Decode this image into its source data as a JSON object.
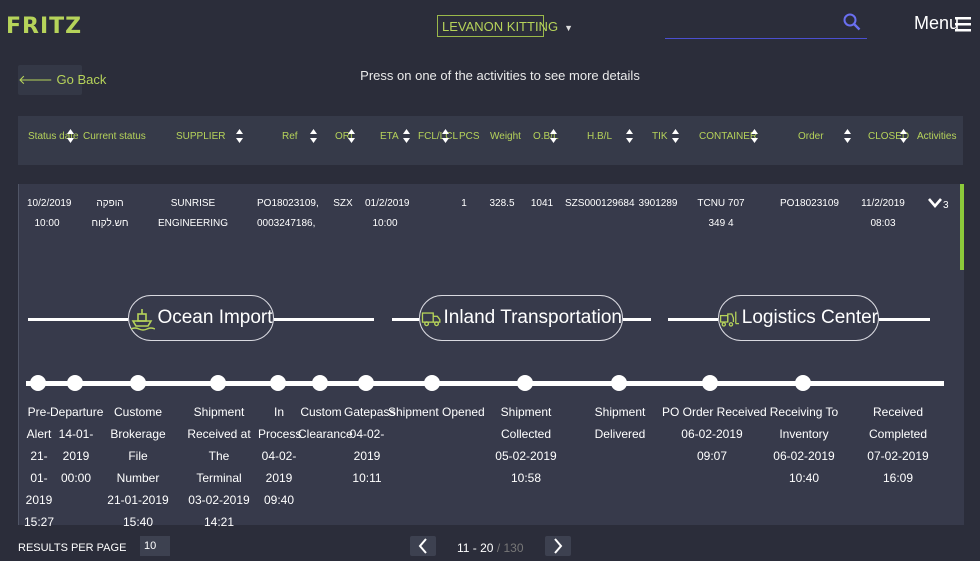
{
  "header": {
    "logo": "FRITZ",
    "customer": "LEVANON KITTING",
    "menu_label": "Menu"
  },
  "nav": {
    "go_back": "Go Back",
    "instructions": "Press on one of the activities to see more details"
  },
  "table": {
    "columns": [
      "Status date",
      "Current status",
      "SUPPLIER",
      "Ref",
      "ORI",
      "ETA",
      "FCL/LCL",
      "PCS",
      "Weight",
      "O.B/L",
      "H.B/L",
      "TIK",
      "CONTAINER",
      "Order",
      "CLOSED",
      "Activities"
    ],
    "row": {
      "status_date_1": "10/2/2019",
      "status_date_2": "10:00",
      "current_status": "הופקה חש.לקוח",
      "supplier": "SUNRISE ENGINEERING",
      "ref_1": "PO18023109,",
      "ref_2": "0003247186,",
      "ori": "SZX",
      "eta_1": "01/2/2019",
      "eta_2": "10:00",
      "pcs": "1",
      "weight": "328.5",
      "obl": "1041",
      "hbl": "SZS000129684",
      "tik": "3901289",
      "container": "TCNU 707 349 4",
      "order": "PO18023109",
      "closed_1": "11/2/2019",
      "closed_2": "08:03",
      "activities_count": "3"
    }
  },
  "stages": [
    "Ocean Import",
    "Inland Transportation",
    "Logistics Center"
  ],
  "activities": [
    {
      "l1": "Pre-",
      "l2": "Alert",
      "l3": "21-",
      "l4": "01-",
      "l5": "2019",
      "l6": "15:27"
    },
    {
      "l1": "Departure",
      "l2": "14-01-",
      "l3": "2019",
      "l4": "00:00"
    },
    {
      "l1": "Custome",
      "l2": "Brokerage File",
      "l3": "Number",
      "l4": "21-01-2019",
      "l5": "15:40"
    },
    {
      "l1": "Shipment",
      "l2": "Received at The",
      "l3": "Terminal",
      "l4": "03-02-2019",
      "l5": "14:21"
    },
    {
      "l1": "In",
      "l2": "Process",
      "l3": "04-02-",
      "l4": "2019",
      "l5": "09:40"
    },
    {
      "l1": "Custom",
      "l2": "Clearance"
    },
    {
      "l1": "Gatepass",
      "l2": "04-02-",
      "l3": "2019",
      "l4": "10:11"
    },
    {
      "l1": "Shipment Opened"
    },
    {
      "l1": "Shipment",
      "l2": "Collected",
      "l3": "05-02-2019",
      "l4": "10:58"
    },
    {
      "l1": "Shipment",
      "l2": "Delivered"
    },
    {
      "l1": "PO Order Received",
      "l2": "06-02-2019",
      "l3": "09:07"
    },
    {
      "l1": "Receiving To",
      "l2": "Inventory",
      "l3": "06-02-2019",
      "l4": "10:40"
    },
    {
      "l1": "Received",
      "l2": "Completed",
      "l3": "07-02-2019",
      "l4": "16:09"
    }
  ],
  "footer": {
    "results_per_page_label": "RESULTS PER PAGE",
    "results_per_page_value": "10",
    "range": "11 - 20",
    "total": "/ 130"
  },
  "colors": {
    "accent": "#b6d35a",
    "active_bar": "#8cc93a",
    "background": "#2b2d3a",
    "search_line": "#4b4fd0"
  },
  "icons": [
    "search-icon",
    "menu-icon",
    "arrow-left-icon",
    "sort-icon",
    "chevron-down-icon",
    "ship-icon",
    "truck-icon",
    "forklift-icon"
  ]
}
